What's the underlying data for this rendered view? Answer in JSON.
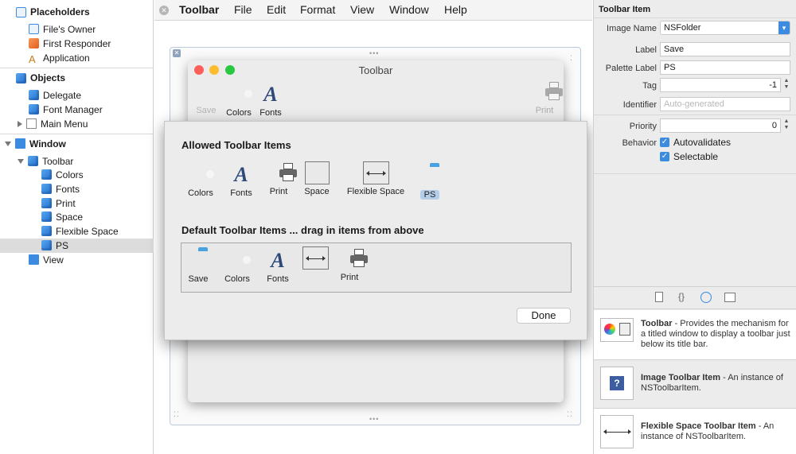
{
  "outline": {
    "placeholders": "Placeholders",
    "files_owner": "File's Owner",
    "first_responder": "First Responder",
    "application": "Application",
    "objects": "Objects",
    "delegate": "Delegate",
    "font_manager": "Font Manager",
    "main_menu": "Main Menu",
    "window": "Window",
    "toolbar": "Toolbar",
    "colors": "Colors",
    "fonts": "Fonts",
    "print": "Print",
    "space": "Space",
    "flexible_space": "Flexible Space",
    "ps": "PS",
    "view": "View"
  },
  "menubar": {
    "items": [
      "Toolbar",
      "File",
      "Edit",
      "Format",
      "View",
      "Window",
      "Help"
    ]
  },
  "window": {
    "title": "Toolbar",
    "items": {
      "save": "Save",
      "colors": "Colors",
      "fonts": "Fonts",
      "print": "Print"
    }
  },
  "sheet": {
    "allowed_title": "Allowed Toolbar Items",
    "allowed": [
      "Colors",
      "Fonts",
      "Print",
      "Space",
      "Flexible Space",
      "PS"
    ],
    "default_title": "Default Toolbar Items ... drag in items from above",
    "defaults": [
      "Save",
      "Colors",
      "Fonts",
      "",
      "Print"
    ],
    "done": "Done"
  },
  "inspector": {
    "section_title": "Toolbar Item",
    "image_name_label": "Image Name",
    "image_name": "NSFolder",
    "label_label": "Label",
    "label_value": "Save",
    "palette_label_label": "Palette Label",
    "palette_label_value": "PS",
    "tag_label": "Tag",
    "tag_value": "-1",
    "identifier_label": "Identifier",
    "identifier_placeholder": "Auto-generated",
    "priority_label": "Priority",
    "priority_value": "0",
    "behavior_label": "Behavior",
    "autovalidates": "Autovalidates",
    "selectable": "Selectable"
  },
  "library": [
    {
      "title": "Toolbar",
      "desc": " - Provides the mechanism for a titled window to display a toolbar just below its title bar."
    },
    {
      "title": "Image Toolbar Item",
      "desc": " - An instance of NSToolbarItem."
    },
    {
      "title": "Flexible Space Toolbar Item",
      "desc": " - An instance of NSToolbarItem."
    }
  ],
  "colors": {
    "accent": "#3b8be0",
    "selection": "#dcdcdc"
  }
}
